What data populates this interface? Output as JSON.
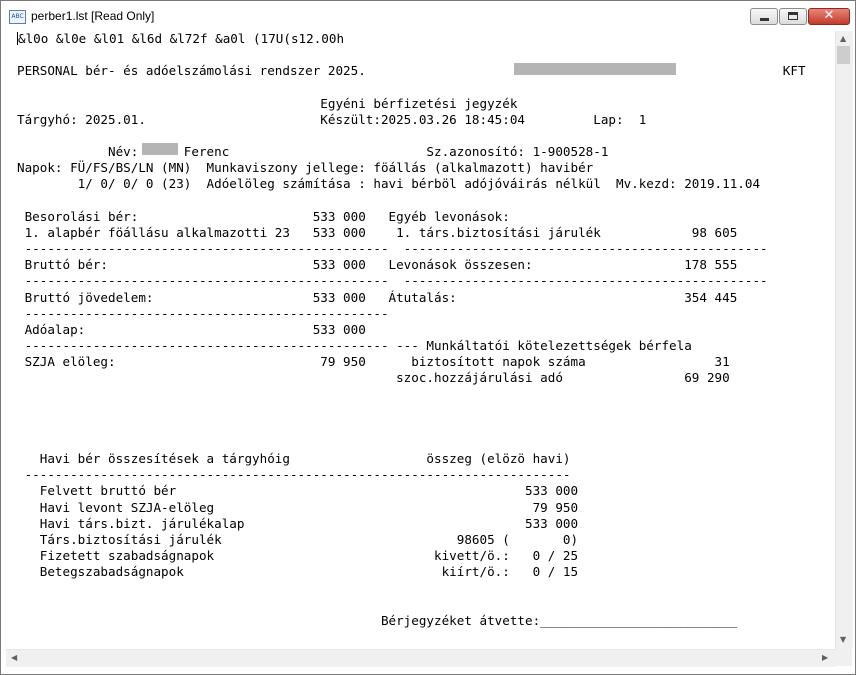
{
  "window": {
    "title": "perber1.lst [Read Only]",
    "icon": "text-file-icon",
    "icon_label": "ABC",
    "close_glyph": "✕"
  },
  "document": {
    "escape_line": "&l0o &l0e &l01 &l6d &l72f &a0l (17U(s12.00h",
    "header": {
      "system": "PERSONAL bér- és adóelszámolási rendszer 2025.",
      "company_suffix": "KFT",
      "doc_title": "Egyéni bérfizetési jegyzék",
      "period_label": "Tárgyhó:",
      "period": "2025.01.",
      "created_label": "Készült:",
      "created": "2025.03.26 18:45:04",
      "page_label": "Lap:",
      "page": "1"
    },
    "employee": {
      "name_label": "Név:",
      "name": "Ferenc",
      "id_label": "Sz.azonosító:",
      "id": "1-900528-1",
      "days_label": "Napok: FÜ/FS/BS/LN (MN)",
      "days_values": "1/ 0/ 0/ 0 (23)",
      "employment_label": "Munkaviszony jellege:",
      "employment": "föállás (alkalmazott) havibér",
      "tax_label": "Adóelöleg számítása :",
      "tax": "havi bérböl adójóváirás nélkül",
      "start_label": "Mv.kezd:",
      "start": "2019.11.04"
    },
    "left_block": [
      {
        "label": "Besorolási bér:",
        "value": "533 000"
      },
      {
        "label": "1. alapbér föállásu alkalmazotti 23",
        "value": "533 000"
      },
      {
        "label": "Bruttó bér:",
        "value": "533 000"
      },
      {
        "label": "Bruttó jövedelem:",
        "value": "533 000"
      },
      {
        "label": "Adóalap:",
        "value": "533 000"
      },
      {
        "label": "SZJA elöleg:",
        "value": "79 950"
      }
    ],
    "right_block": [
      {
        "label": "Egyéb levonások:",
        "value": ""
      },
      {
        "label": "1. társ.biztosítási járulék",
        "value": "98 605"
      },
      {
        "label": "Levonások összesen:",
        "value": "178 555"
      },
      {
        "label": "Átutalás:",
        "value": "354 445"
      },
      {
        "label": "Munkáltatói kötelezettségek bérfela",
        "value": ""
      },
      {
        "label": "biztosított napok száma",
        "value": "31"
      },
      {
        "label": "szoc.hozzájárulási adó",
        "value": "69 290"
      }
    ],
    "summary": {
      "title": "Havi bér összesítések a tárgyhóig",
      "amount_header": "összeg (elözö havi)",
      "rows": [
        {
          "label": "Felvett bruttó bér",
          "value": "533 000"
        },
        {
          "label": "Havi levont SZJA-elöleg",
          "value": "79 950"
        },
        {
          "label": "Havi társ.bizt. járulékalap",
          "value": "533 000"
        },
        {
          "label": "Társ.biztosítási járulék",
          "value": "98605 (       0)"
        },
        {
          "label": "Fizetett szabadságnapok",
          "value": "kivett/ö.:   0 / 25"
        },
        {
          "label": "Betegszabadságnapok",
          "value": "kiírt/ö.:   0 / 15"
        }
      ]
    },
    "receipt_label": "Bérjegyzéket átvette:"
  },
  "redaction_color": "#b4b4b4",
  "close_button_color": "#c23a2a"
}
